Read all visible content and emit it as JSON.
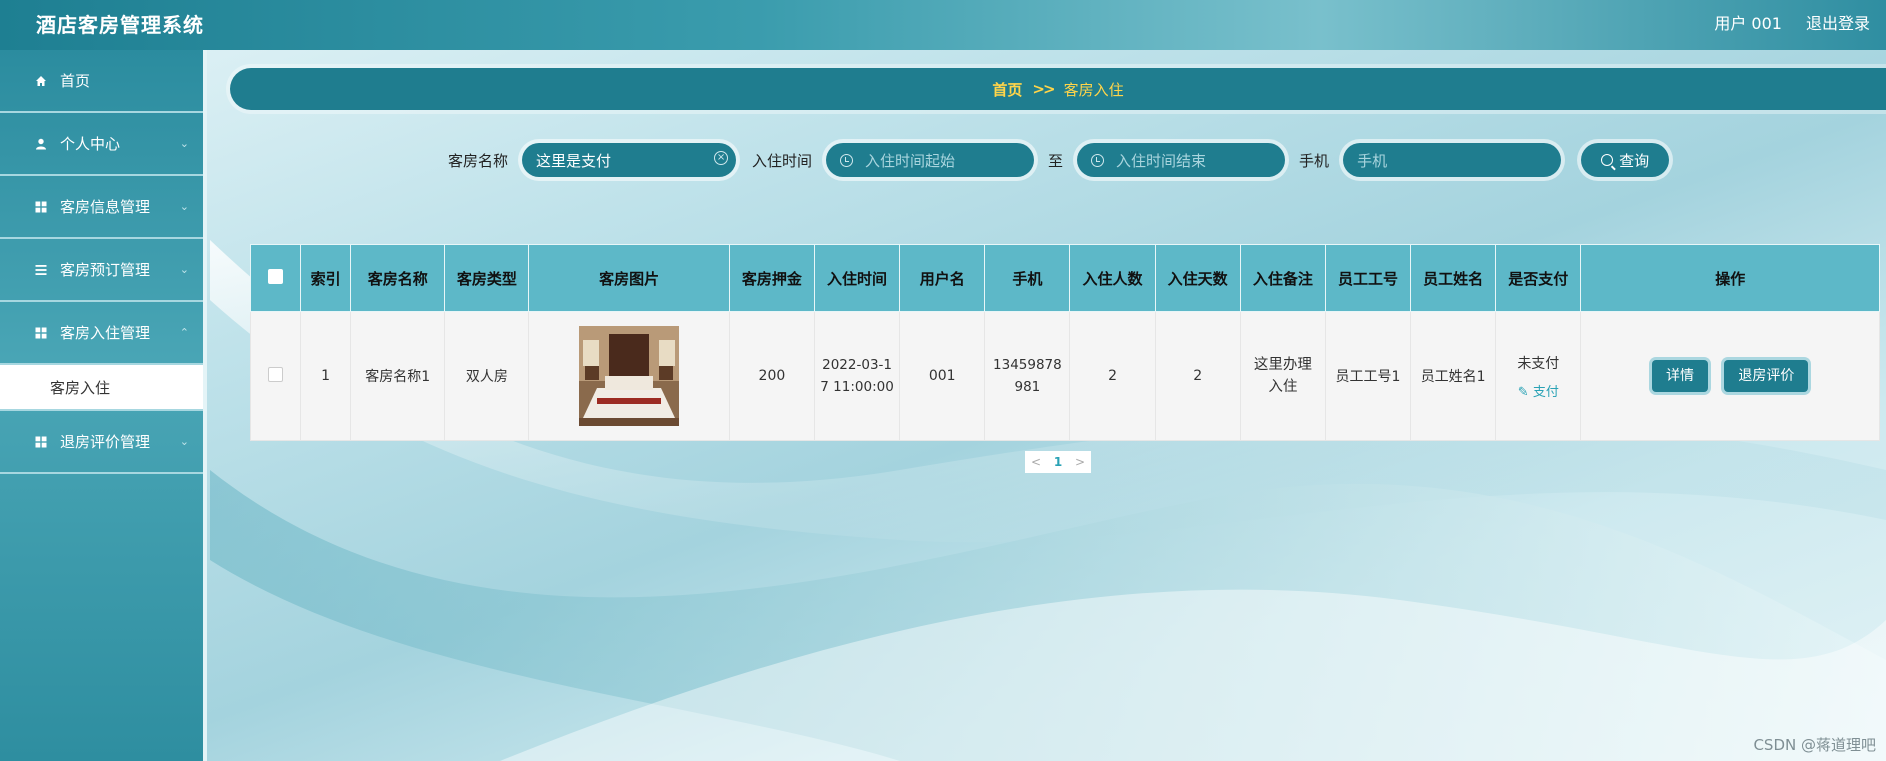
{
  "header": {
    "app_title": "酒店客房管理系统",
    "user_label": "用户 001",
    "logout_label": "退出登录"
  },
  "sidebar": {
    "items": [
      {
        "label": "首页",
        "icon": "home-icon"
      },
      {
        "label": "个人中心",
        "icon": "user-icon"
      },
      {
        "label": "客房信息管理",
        "icon": "grid-icon"
      },
      {
        "label": "客房预订管理",
        "icon": "list-icon"
      },
      {
        "label": "客房入住管理",
        "icon": "grid-icon"
      },
      {
        "label": "退房评价管理",
        "icon": "grid-icon"
      }
    ],
    "active_sub": "客房入住"
  },
  "breadcrumb": {
    "home": "首页",
    "separator": ">>",
    "current": "客房入住"
  },
  "search": {
    "room_name_label": "客房名称",
    "room_name_value": "这里是支付",
    "checkin_time_label": "入住时间",
    "start_placeholder": "入住时间起始",
    "to_label": "至",
    "end_placeholder": "入住时间结束",
    "phone_label": "手机",
    "phone_placeholder": "手机",
    "query_button": "查询"
  },
  "table": {
    "columns": [
      "索引",
      "客房名称",
      "客房类型",
      "客房图片",
      "客房押金",
      "入住时间",
      "用户名",
      "手机",
      "入住人数",
      "入住天数",
      "入住备注",
      "员工工号",
      "员工姓名",
      "是否支付",
      "操作"
    ],
    "rows": [
      {
        "index": "1",
        "room_name": "客房名称1",
        "room_type": "双人房",
        "deposit": "200",
        "checkin_time": "2022-03-17 11:00:00",
        "username": "001",
        "phone": "13459878981",
        "guests": "2",
        "days": "2",
        "note": "这里办理入住",
        "staff_no": "员工工号1",
        "staff_name": "员工姓名1",
        "paid_status": "未支付",
        "pay_link": "支付",
        "detail_button": "详情",
        "review_button": "退房评价"
      }
    ]
  },
  "pagination": {
    "prev": "<",
    "current_page": "1",
    "next": ">"
  },
  "watermark": "CSDN @蒋道理吧",
  "colors": {
    "primary": "#1f7d8f",
    "header_row": "#5db8c8",
    "breadcrumb_text": "#ffd54a",
    "link": "#2aa2b5"
  }
}
